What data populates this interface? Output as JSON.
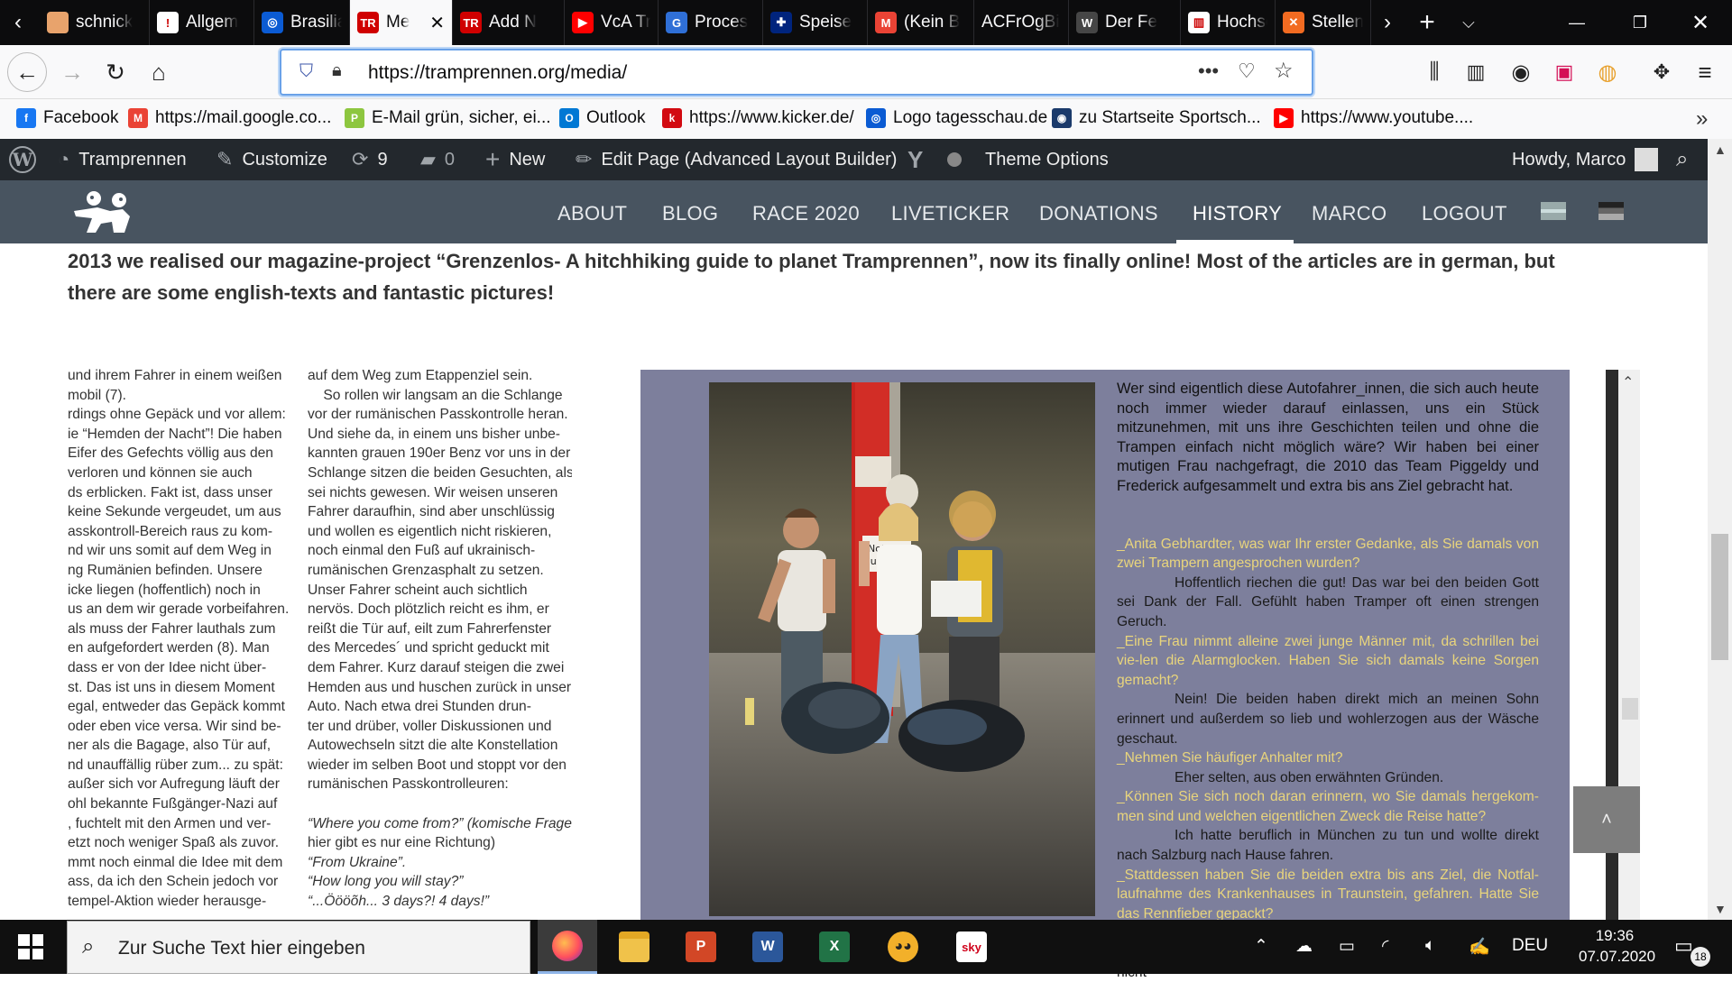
{
  "browser": {
    "tabs": [
      {
        "label": "schnick",
        "icon_color": "#e8a36c",
        "icon_glyph": ""
      },
      {
        "label": "Allgem",
        "icon_color": "#ffffff",
        "icon_glyph": "!"
      },
      {
        "label": "Brasilia",
        "icon_color": "#0b5bd3",
        "icon_glyph": "◎"
      },
      {
        "label": "Me",
        "icon_color": "#d00000",
        "icon_glyph": "TR",
        "active": true
      },
      {
        "label": "Add N",
        "icon_color": "#d00000",
        "icon_glyph": "TR"
      },
      {
        "label": "VcA Tr",
        "icon_color": "#ff0000",
        "icon_glyph": "▶"
      },
      {
        "label": "Proces",
        "icon_color": "#2f6fd6",
        "icon_glyph": "G"
      },
      {
        "label": "Speise",
        "icon_color": "#00247d",
        "icon_glyph": "✚"
      },
      {
        "label": "(Kein B",
        "icon_color": "#ea4335",
        "icon_glyph": "M"
      },
      {
        "label": "ACFrOgBi",
        "icon_color": "",
        "icon_glyph": ""
      },
      {
        "label": "Der Fe",
        "icon_color": "#464646",
        "icon_glyph": "W"
      },
      {
        "label": "Hochsc",
        "icon_color": "#ffffff",
        "icon_glyph": "▥"
      },
      {
        "label": "Stellen",
        "icon_color": "#f26b21",
        "icon_glyph": "✕"
      }
    ],
    "url": "https://tramprennen.org/media/",
    "bookmarks": [
      {
        "label": "Facebook",
        "icon_color": "#1877f2",
        "icon_glyph": "f"
      },
      {
        "label": "https://mail.google.co...",
        "icon_color": "#ea4335",
        "icon_glyph": "M"
      },
      {
        "label": "E-Mail grün, sicher, ei...",
        "icon_color": "#8dc63f",
        "icon_glyph": "P"
      },
      {
        "label": "Outlook",
        "icon_color": "#0078d4",
        "icon_glyph": "O"
      },
      {
        "label": "https://www.kicker.de/",
        "icon_color": "#d20a11",
        "icon_glyph": "k"
      },
      {
        "label": "Logo tagesschau.de",
        "icon_color": "#0b5bd3",
        "icon_glyph": "◎"
      },
      {
        "label": "zu Startseite Sportsch...",
        "icon_color": "#1b3a6b",
        "icon_glyph": "◉"
      },
      {
        "label": "https://www.youtube....",
        "icon_color": "#ff0000",
        "icon_glyph": "▶"
      }
    ]
  },
  "wp_admin": {
    "site": "Tramprennen",
    "customize": "Customize",
    "updates": "9",
    "comments": "0",
    "new": "New",
    "edit": "Edit Page (Advanced Layout Builder)",
    "theme_options": "Theme Options",
    "howdy": "Howdy, Marco"
  },
  "site_menu": [
    "ABOUT",
    "BLOG",
    "RACE 2020",
    "LIVETICKER",
    "DONATIONS",
    "HISTORY",
    "MARCO",
    "LOGOUT"
  ],
  "intro": "2013 we realised our magazine-project “Grenzenlos- A hitchhiking guide to planet Tramprennen”, now its finally online! Most of the articles are in german, but there are some english-texts and fantastic pictures!",
  "col1": [
    "und ihrem Fahrer in einem weißen",
    "mobil (7).",
    "rdings ohne Gepäck und vor allem:",
    "ie “Hemden der Nacht”! Die haben",
    "Eifer des Gefechts völlig aus den",
    "verloren und können sie auch",
    "ds erblicken. Fakt ist, dass unser",
    "keine Sekunde vergeudet, um aus",
    "asskontroll-Bereich raus zu kom-",
    "nd wir uns somit auf dem Weg in",
    "ng Rumänien befinden. Unsere",
    "icke liegen (hoffentlich) noch in",
    "us an dem wir gerade vorbeifahren.",
    "als muss der Fahrer lauthals zum",
    "en aufgefordert werden (8). Man",
    "dass er von der Idee nicht über-",
    "st. Das ist uns in diesem Moment",
    "egal, entweder das Gepäck kommt",
    "oder eben vice versa. Wir sind be-",
    "ner als die Bagage, also Tür auf,",
    "nd unauffällig rüber zum... zu spät:",
    "außer sich vor Aufregung läuft der",
    "ohl bekannte Fußgänger-Nazi auf",
    ", fuchtelt mit den Armen und ver-",
    "etzt noch weniger Spaß als zuvor.",
    "mmt noch einmal die Idee mit dem",
    "ass, da ich den Schein jedoch vor",
    "tempel-Aktion wieder herausge-"
  ],
  "col2": [
    "auf dem Weg zum Etappenziel sein.",
    "    So rollen wir langsam an die Schlange",
    "vor der rumänischen Passkontrolle heran.",
    "Und siehe da, in einem uns bisher unbe-",
    "kannten grauen 190er Benz vor uns in der",
    "Schlange sitzen die beiden Gesuchten, als",
    "sei nichts gewesen. Wir weisen unseren",
    "Fahrer daraufhin, sind aber unschlüssig",
    "und wollen es eigentlich nicht riskieren,",
    "noch einmal den Fuß auf ukrainisch-",
    "rumänischen Grenzasphalt zu setzen.",
    "Unser Fahrer scheint auch sichtlich",
    "nervös. Doch plötzlich reicht es ihm, er",
    "reißt die Tür auf, eilt zum Fahrerfenster",
    "des Mercedes´ und spricht geduckt mit",
    "dem Fahrer. Kurz darauf steigen die zwei",
    "Hemden aus und huschen zurück in unser",
    "Auto. Nach etwa drei Stunden drun-",
    "ter und drüber, voller Diskussionen und",
    "Autowechseln sitzt die alte Konstellation",
    "wieder im selben Boot und stoppt vor den",
    "rumänischen Passkontrolleuren:",
    "",
    "“Where you come from?” (komische Frage,",
    "hier gibt es nur eine Richtung)",
    "“From Ukraine”.",
    "“How long you will stay?”",
    "“...Öööõh... 3 days?! 4 days!”"
  ],
  "mag": {
    "lead": "Wer sind eigentlich diese Autofahrer_innen, die sich auch heute noch immer wieder darauf einlassen, uns ein Stück mitzunehmen, mit uns ihre Geschichten teilen und ohne die Trampen einfach nicht möglich wäre? Wir haben bei einer mutigen Frau nachgefragt, die 2010 das Team Piggeldy und Frederick aufgesammelt und extra bis ans Ziel gebracht hat.",
    "qa": [
      {
        "q": "_Anita Gebhardter, was war Ihr erster Gedanke, als Sie damals von zwei Trampern angesprochen wurden?",
        "a": "Hoffentlich riechen die gut! Das war bei den beiden Gott sei Dank der Fall. Gefühlt haben Tramper oft einen strengen Geruch."
      },
      {
        "q": "_Eine Frau nimmt alleine zwei junge Männer mit, da schrillen bei vie-len die Alarmglocken. Haben Sie sich damals keine Sorgen gemacht?",
        "a": "Nein! Die beiden haben direkt mich an meinen Sohn erinnert und außerdem so lieb und wohlerzogen aus der Wäsche geschaut."
      },
      {
        "q": "_Nehmen Sie häufiger Anhalter mit?",
        "a": "Eher selten, aus oben erwähnten Gründen."
      },
      {
        "q": "_Können Sie sich noch daran erinnern, wo Sie damals hergekom-men sind und welchen eigentlichen Zweck die Reise hatte?",
        "a": "Ich hatte beruflich in München zu tun und wollte direkt nach Salzburg nach Hause fahren."
      },
      {
        "q": "_Stattdessen haben Sie die beiden extra bis ans Ziel, die Notfal-laufnahme des Krankenhauses in Traunstein, gefahren. Hatte Sie das Rennfieber gepackt?",
        "a": "Ich fand das Konzept des Tramprennens so spannend und die beiden waren super höflich und nett. Ich hatte es einfach nicht"
      }
    ],
    "photo_sign": "Notfall-\naufnahme"
  },
  "taskbar": {
    "search_placeholder": "Zur Suche Text hier eingeben",
    "lang": "DEU",
    "time": "19:36",
    "date": "07.07.2020",
    "notifications": "18"
  }
}
